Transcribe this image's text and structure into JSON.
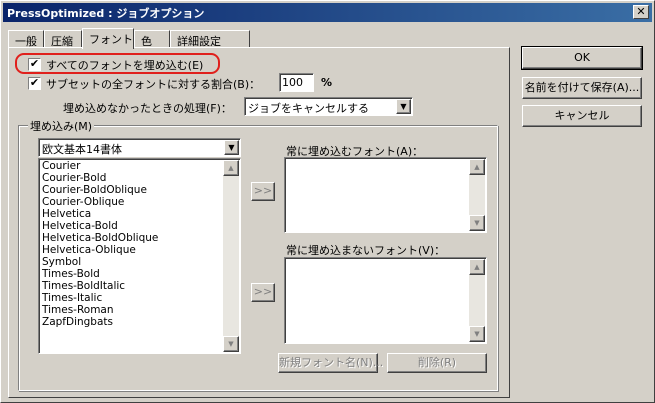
{
  "window": {
    "title": "PressOptimized : ジョブオプション",
    "close_label": "✕"
  },
  "tabs": [
    {
      "label": "一般"
    },
    {
      "label": "圧縮"
    },
    {
      "label": "フォント"
    },
    {
      "label": "色"
    },
    {
      "label": "詳細設定"
    }
  ],
  "active_tab": "フォント",
  "embed_all": {
    "label": "すべてのフォントを埋め込む(E)",
    "checked": "✔"
  },
  "subset": {
    "label": "サブセットの全フォントに対する割合(B)：",
    "checked": "✔",
    "value": "100",
    "unit": "%"
  },
  "failure": {
    "label": "埋め込めなかったときの処理(F)：",
    "selected": "ジョブをキャンセルする"
  },
  "embed_group": {
    "title": "埋め込み(M)",
    "source_selected": "欧文基本14書体",
    "fonts": [
      "Courier",
      "Courier-Bold",
      "Courier-BoldOblique",
      "Courier-Oblique",
      "Helvetica",
      "Helvetica-Bold",
      "Helvetica-BoldOblique",
      "Helvetica-Oblique",
      "Symbol",
      "Times-Bold",
      "Times-BoldItalic",
      "Times-Italic",
      "Times-Roman",
      "ZapfDingbats"
    ],
    "always_embed_label": "常に埋め込むフォント(A)：",
    "never_embed_label": "常に埋め込まないフォント(V)：",
    "add_arrow": ">>",
    "new_font_button": "新規フォント名(N)...",
    "delete_button": "削除(R)"
  },
  "buttons": {
    "ok": "OK",
    "save_as": "名前を付けて保存(A)...",
    "cancel": "キャンセル"
  },
  "colors": {
    "highlight_ring": "#e0201c",
    "titlebar_start": "#0a246a",
    "titlebar_end": "#3a6ea5"
  }
}
